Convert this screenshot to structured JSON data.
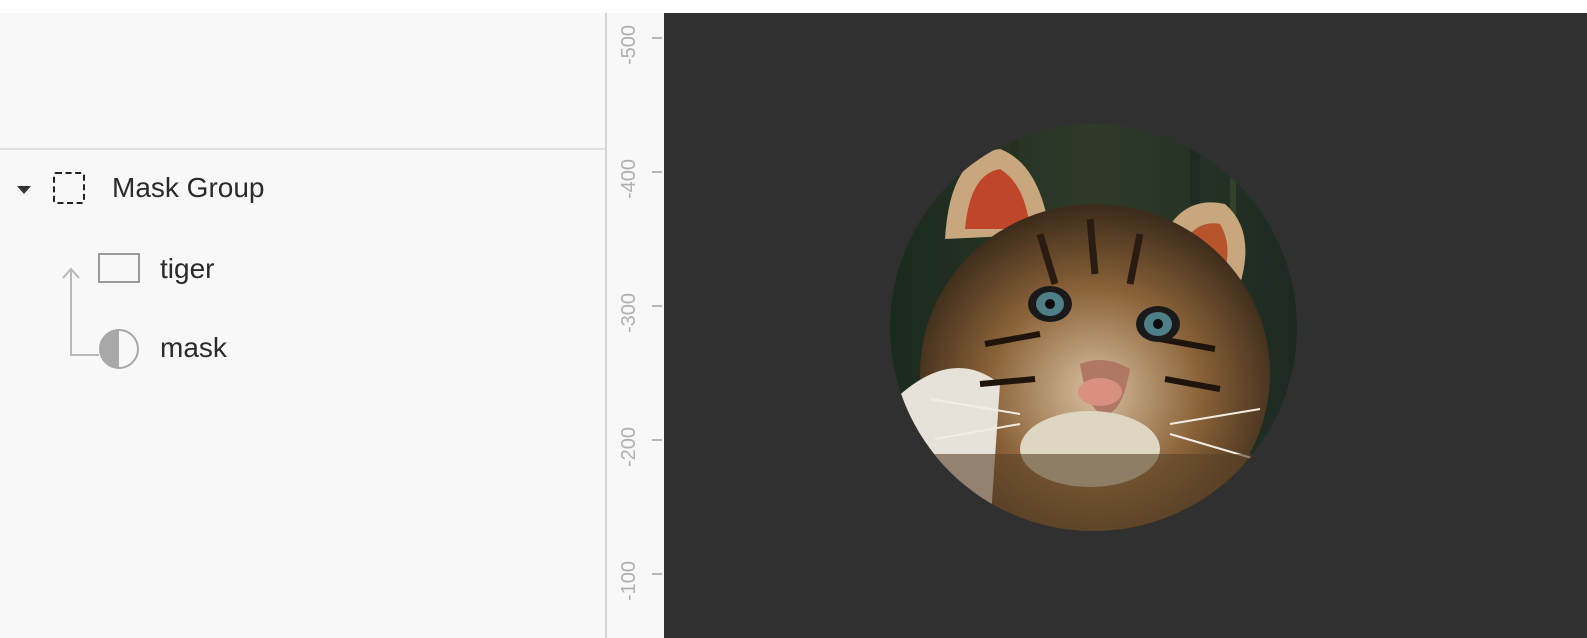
{
  "layers": {
    "group": {
      "label": "Mask Group",
      "icon": "dashed-square-icon"
    },
    "children": [
      {
        "label": "tiger",
        "icon": "rectangle-icon"
      },
      {
        "label": "mask",
        "icon": "mask-circle-icon"
      }
    ]
  },
  "ruler": {
    "ticks": [
      "-500",
      "-400",
      "-300",
      "-200",
      "-100"
    ]
  },
  "canvas": {
    "background": "#303030",
    "image_alt": "tiger"
  }
}
